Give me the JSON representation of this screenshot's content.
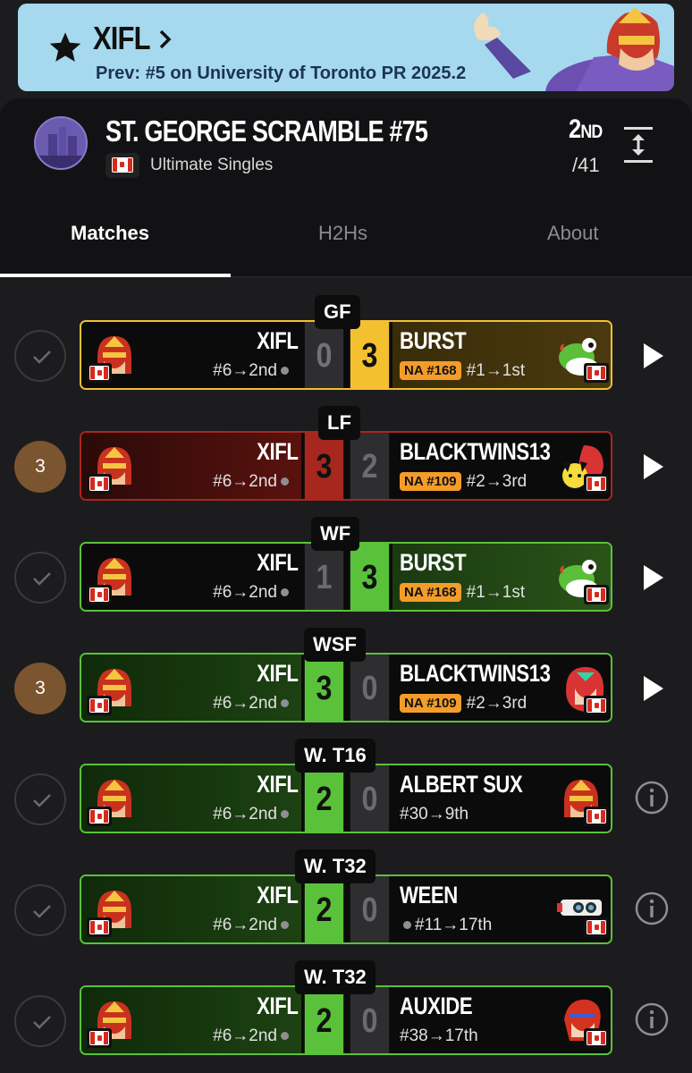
{
  "banner": {
    "player": "XIFL",
    "prev": "Prev: #5 on University of Toronto PR 2025.2"
  },
  "tournament": {
    "title": "ST. GEORGE SCRAMBLE #75",
    "game": "Ultimate Singles",
    "placing": "2",
    "placing_suffix": "ND",
    "entrants": "/41"
  },
  "tabs": [
    "Matches",
    "H2Hs",
    "About"
  ],
  "matches": [
    {
      "round": "GF",
      "left_status": "",
      "p1": "XIFL",
      "p1_seed": "#6→2nd",
      "s1": "0",
      "s2": "3",
      "p2": "BURST",
      "p2_tag": "NA #168",
      "p2_seed": "#1→1st",
      "action": "play"
    },
    {
      "round": "LF",
      "left_status": "3",
      "p1": "XIFL",
      "p1_seed": "#6→2nd",
      "s1": "3",
      "s2": "2",
      "p2": "BLACKTWINS13",
      "p2_tag": "NA #109",
      "p2_seed": "#2→3rd",
      "action": "play"
    },
    {
      "round": "WF",
      "left_status": "",
      "p1": "XIFL",
      "p1_seed": "#6→2nd",
      "s1": "1",
      "s2": "3",
      "p2": "BURST",
      "p2_tag": "NA #168",
      "p2_seed": "#1→1st",
      "action": "play"
    },
    {
      "round": "WSF",
      "left_status": "3",
      "p1": "XIFL",
      "p1_seed": "#6→2nd",
      "s1": "3",
      "s2": "0",
      "p2": "BLACKTWINS13",
      "p2_tag": "NA #109",
      "p2_seed": "#2→3rd",
      "action": "play"
    },
    {
      "round": "W. T16",
      "left_status": "",
      "p1": "XIFL",
      "p1_seed": "#6→2nd",
      "s1": "2",
      "s2": "0",
      "p2": "ALBERT SUX",
      "p2_tag": "",
      "p2_seed": "#30→9th",
      "action": "info"
    },
    {
      "round": "W. T32",
      "left_status": "",
      "p1": "XIFL",
      "p1_seed": "#6→2nd",
      "s1": "2",
      "s2": "0",
      "p2": "WEEN",
      "p2_tag": "",
      "p2_seed": "#11→17th",
      "action": "info"
    },
    {
      "round": "W. T32",
      "left_status": "",
      "p1": "XIFL",
      "p1_seed": "#6→2nd",
      "s1": "2",
      "s2": "0",
      "p2": "AUXIDE",
      "p2_tag": "",
      "p2_seed": "#38→17th",
      "action": "info"
    }
  ]
}
